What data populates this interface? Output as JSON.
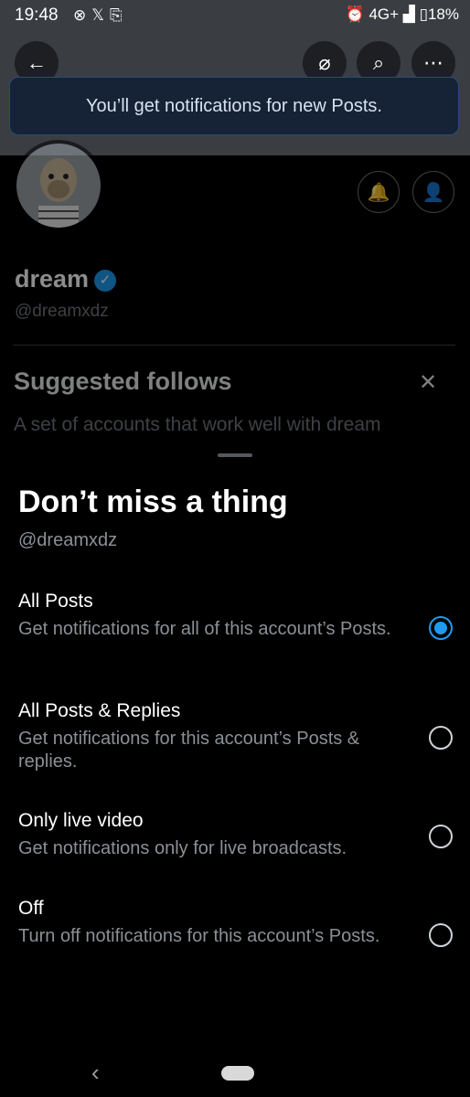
{
  "status_bar": {
    "time": "19:48",
    "network": "4G+",
    "battery": "18%"
  },
  "toast": {
    "message": "You’ll get notifications for new Posts."
  },
  "profile": {
    "name": "dream",
    "handle": "@dreamxdz"
  },
  "suggested": {
    "title": "Suggested follows",
    "subtitle": "A set of accounts that work well with dream"
  },
  "sheet": {
    "title": "Don’t miss a thing",
    "handle": "@dreamxdz",
    "options": [
      {
        "label": "All Posts",
        "description": "Get notifications for all of this account’s Posts.",
        "selected": true
      },
      {
        "label": "All Posts & Replies",
        "description": "Get notifications for this account’s Posts & replies.",
        "selected": false
      },
      {
        "label": "Only live video",
        "description": "Get notifications only for live broadcasts.",
        "selected": false
      },
      {
        "label": "Off",
        "description": "Turn off notifications for this account’s Posts.",
        "selected": false
      }
    ]
  },
  "colors": {
    "accent": "#1d9bf0",
    "toast_bg": "#162235",
    "background": "#000000"
  }
}
